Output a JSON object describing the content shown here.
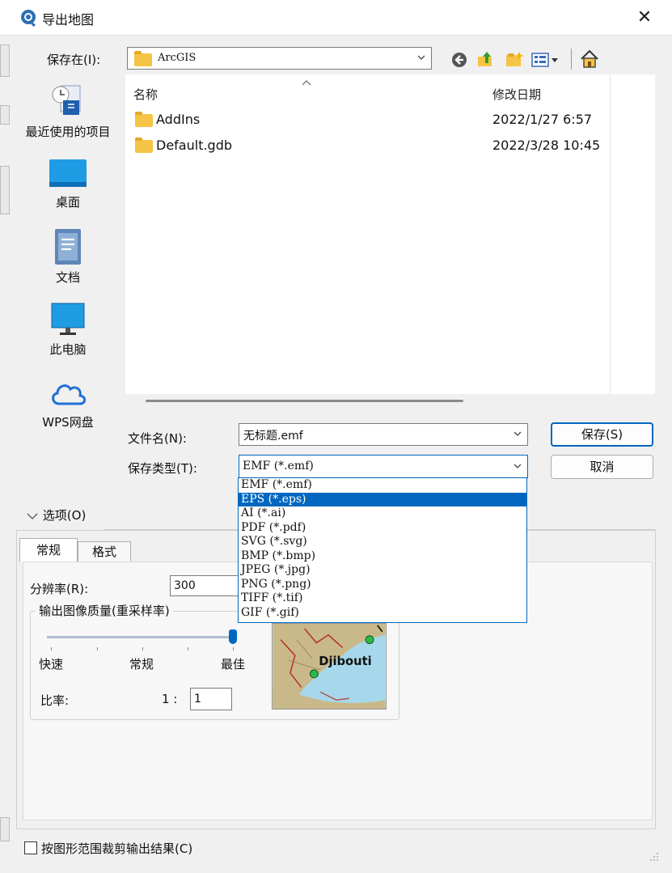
{
  "window": {
    "title": "导出地图",
    "close_symbol": "✕"
  },
  "save_in": {
    "label": "保存在(I):",
    "value": "ArcGIS"
  },
  "toolbar_icons": [
    "back-icon",
    "up-folder-icon",
    "new-folder-icon",
    "view-menu-icon",
    "home-icon"
  ],
  "places": [
    {
      "label": "最近使用的项目",
      "icon": "recent-icon"
    },
    {
      "label": "桌面",
      "icon": "desktop-icon"
    },
    {
      "label": "文档",
      "icon": "documents-icon"
    },
    {
      "label": "此电脑",
      "icon": "computer-icon"
    },
    {
      "label": "WPS网盘",
      "icon": "cloud-icon"
    }
  ],
  "file_list": {
    "columns": [
      "名称",
      "修改日期"
    ],
    "rows": [
      {
        "name": "AddIns",
        "date": "2022/1/27 6:57"
      },
      {
        "name": "Default.gdb",
        "date": "2022/3/28 10:45"
      }
    ]
  },
  "filename": {
    "label": "文件名(N):",
    "value": "无标题.emf"
  },
  "filetype": {
    "label": "保存类型(T):",
    "value": "EMF (*.emf)",
    "options": [
      "EMF (*.emf)",
      "EPS (*.eps)",
      "AI (*.ai)",
      "PDF (*.pdf)",
      "SVG (*.svg)",
      "BMP (*.bmp)",
      "JPEG (*.jpg)",
      "PNG (*.png)",
      "TIFF (*.tif)",
      "GIF (*.gif)"
    ],
    "highlighted_index": 1
  },
  "buttons": {
    "save": "保存(S)",
    "cancel": "取消"
  },
  "options": {
    "toggle_label": "选项(O)",
    "tabs": [
      "常规",
      "格式"
    ],
    "resolution_label": "分辨率(R):",
    "resolution_value": "300",
    "quality_group_label": "输出图像质量(重采样率)",
    "slider_labels": [
      "快速",
      "常规",
      "最佳"
    ],
    "slider_level": 1.0,
    "ratio_label": "比率:",
    "ratio_prefix": "1 :",
    "ratio_value": "1",
    "preview_place_label": "Djibouti"
  },
  "clip_checkbox": {
    "label": "按图形范围裁剪输出结果(C)",
    "checked": false
  },
  "colors": {
    "accent": "#0067c0",
    "folder": "#f5c445",
    "water": "#a7d7ea",
    "land": "#c9b98a"
  }
}
